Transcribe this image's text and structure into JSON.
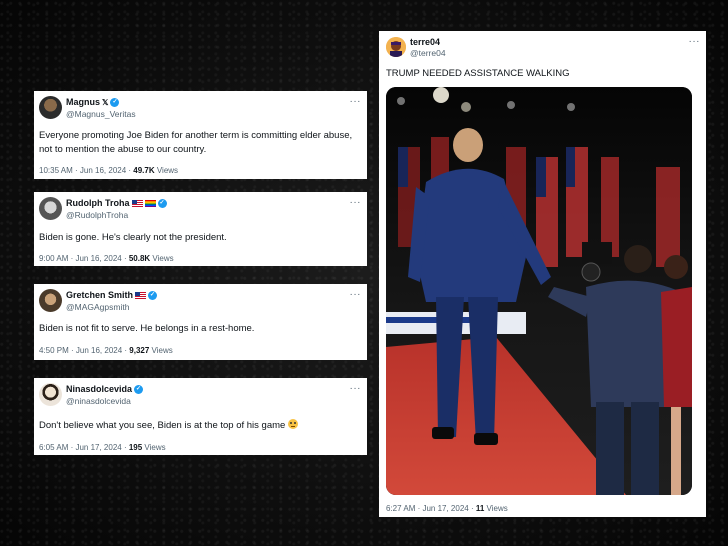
{
  "tweets": [
    {
      "name": "Magnus",
      "handle": "@Magnus_Veritas",
      "text": "Everyone promoting Joe Biden for another term is committing elder abuse, not to mention the abuse to our country.",
      "time": "10:35 AM · Jun 16, 2024 · ",
      "views": "49.7K",
      "views_label": " Views"
    },
    {
      "name": "Rudolph Troha",
      "handle": "@RudolphTroha",
      "text": "Biden is gone. He's clearly not the president.",
      "time": "9:00 AM · Jun 16, 2024 · ",
      "views": "50.8K",
      "views_label": " Views"
    },
    {
      "name": "Gretchen Smith",
      "handle": "@MAGAgpsmith",
      "text": "Biden is not fit to serve. He belongs in a rest-home.",
      "time": "4:50 PM · Jun 16, 2024 · ",
      "views": "9,327",
      "views_label": " Views"
    },
    {
      "name": "Ninasdolcevida",
      "handle": "@ninasdolcevida",
      "text": "Don't believe what you see, Biden is at the top of his game",
      "time": "6:05 AM · Jun 17, 2024 · ",
      "views": "195",
      "views_label": " Views"
    }
  ],
  "big_tweet": {
    "name": "terre04",
    "handle": "@terre04",
    "text": "TRUMP NEEDED ASSISTANCE WALKING",
    "time": "6:27 AM · Jun 17, 2024 · ",
    "views": "11",
    "views_label": " Views"
  },
  "more_glyph": "···",
  "colors": {
    "verified": "#1d9bf0",
    "muted": "#536471",
    "carpet": "#c8382c"
  }
}
